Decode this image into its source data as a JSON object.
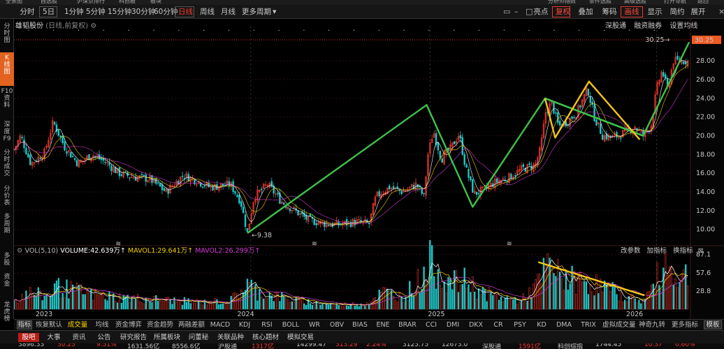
{
  "menu_bar": {
    "items": [
      "全景图",
      "自选股",
      "沪深京排行",
      "科创板",
      "板块"
    ],
    "right_items": [
      "分析师指数",
      "条件选股",
      "高级选股",
      "打开导航",
      "返回"
    ]
  },
  "period_toolbar": {
    "periods": [
      "分时",
      "5日",
      "1分钟",
      "5分钟",
      "15分钟",
      "30分钟",
      "60分钟",
      "日线",
      "周线",
      "月线",
      "更多周期"
    ],
    "dropdown_suffix": "▼",
    "active_period": "日线",
    "right_buttons": [
      "亮点",
      "复权",
      "叠加",
      "筹码",
      "画线",
      "显示",
      "简约",
      "展开"
    ],
    "red_buttons": [
      "复权",
      "画线"
    ]
  },
  "sidebar": {
    "items": [
      "分\n时\n图",
      "K\n线\n图",
      "F10\n资\n料",
      "深\n度\nF9",
      "分\n时\n成\n交",
      "分\n价\n表",
      "多\n周\n期",
      "多\n股",
      "资\n金",
      "龙\n虎\n榜"
    ],
    "active_item": "K\n线\n图"
  },
  "chart_header": {
    "stock_name": "雄韬股份",
    "mode": "(日线,前复权)",
    "settings_icon": "gear-icon",
    "links": [
      "深股通",
      "融资融券",
      "设置均线"
    ]
  },
  "volume_header": {
    "label": "VOL(5,10)",
    "volume": "VOLUME:42.639万",
    "mavol1": "MAVOL1:29.641万",
    "mavol2": "MAVOL2:26.299万",
    "arrow": "↑",
    "links": [
      "改参数",
      "加指标",
      "换指标"
    ],
    "colors": {
      "label": "#bbbbbb",
      "volume": "#ffffff",
      "mavol1": "#f5d000",
      "mavol2": "#d43ad4"
    }
  },
  "indicator_tabs": {
    "items": [
      "指标",
      "恢复默认",
      "成交量",
      "均线",
      "资金博弈",
      "资金趋势",
      "两融差额",
      "MACD",
      "KDJ",
      "RSI",
      "BOLL",
      "WR",
      "OBV",
      "BIAS",
      "ENE",
      "BRAR",
      "CCI",
      "DMI",
      "DKX",
      "CR",
      "PSY",
      "KD",
      "DMA",
      "TRIX",
      "虚拟成交量",
      "神奇九转",
      "更多指标",
      "模板"
    ],
    "active": "成交量"
  },
  "bottom_tabs": {
    "items": [
      "股吧",
      "大事",
      "资讯",
      "公告",
      "研究报告",
      "所属板块",
      "问董秘",
      "关联品种",
      "核心题材",
      "模拟交易"
    ],
    "active": "股吧"
  },
  "status_bar": {
    "items": [
      "3896.33",
      "30.25",
      "9.51%",
      "1631.56亿",
      "8556.6亿",
      "沪股通",
      "1317亿",
      "14299.47",
      "313.29",
      "2.24%",
      "3125.75",
      "12673.0",
      "深股通",
      "1591亿",
      "科创综指",
      "1744.45",
      "10.37",
      "0.60%"
    ]
  },
  "colors": {
    "up": "#ff3b30",
    "down": "#1ec8c8",
    "trend_line": "#3ec24a",
    "highlight_line": "#f5c518",
    "price_label_bg": "#ee5a24",
    "ma5": "#ffffff",
    "ma10": "#f5d000",
    "ma20": "#d43ad4"
  },
  "chart_data": [
    {
      "type": "candlestick",
      "title": "雄韬股份 (日线,前复权)",
      "x_labels": [
        "2023",
        "2024",
        "2025",
        "2026"
      ],
      "y_ticks": [
        10.0,
        12.0,
        14.0,
        16.0,
        18.0,
        20.0,
        22.0,
        24.0,
        26.0,
        28.0
      ],
      "ylim": [
        9.0,
        31.0
      ],
      "current_price": 30.25,
      "high_label": "30.25",
      "low_label": "9.38",
      "price_path": [
        [
          0,
          18.5
        ],
        [
          10,
          20.0
        ],
        [
          25,
          17.0
        ],
        [
          45,
          18.2
        ],
        [
          58,
          21.5
        ],
        [
          75,
          18.8
        ],
        [
          95,
          17.0
        ],
        [
          115,
          18.0
        ],
        [
          135,
          17.2
        ],
        [
          155,
          16.0
        ],
        [
          175,
          15.6
        ],
        [
          200,
          15.4
        ],
        [
          225,
          14.0
        ],
        [
          250,
          15.8
        ],
        [
          270,
          15.2
        ],
        [
          290,
          14.5
        ],
        [
          320,
          14.8
        ],
        [
          335,
          13.0
        ],
        [
          345,
          9.6
        ],
        [
          355,
          13.5
        ],
        [
          375,
          14.8
        ],
        [
          395,
          13.0
        ],
        [
          415,
          12.0
        ],
        [
          435,
          11.0
        ],
        [
          460,
          10.6
        ],
        [
          480,
          10.5
        ],
        [
          505,
          10.8
        ],
        [
          525,
          10.6
        ],
        [
          535,
          13.5
        ],
        [
          555,
          14.5
        ],
        [
          575,
          14.0
        ],
        [
          595,
          14.8
        ],
        [
          606,
          13.5
        ],
        [
          612,
          18.0
        ],
        [
          620,
          20.5
        ],
        [
          632,
          17.5
        ],
        [
          645,
          18.6
        ],
        [
          658,
          20.2
        ],
        [
          668,
          16.5
        ],
        [
          680,
          13.8
        ],
        [
          695,
          14.2
        ],
        [
          710,
          15.0
        ],
        [
          730,
          15.5
        ],
        [
          752,
          16.5
        ],
        [
          770,
          16.8
        ],
        [
          778,
          18.5
        ],
        [
          786,
          22.5
        ],
        [
          795,
          23.5
        ],
        [
          805,
          21.0
        ],
        [
          818,
          21.5
        ],
        [
          832,
          22.5
        ],
        [
          848,
          25.0
        ],
        [
          858,
          22.0
        ],
        [
          870,
          20.0
        ],
        [
          885,
          19.8
        ],
        [
          905,
          20.4
        ],
        [
          918,
          21.0
        ],
        [
          930,
          20.0
        ],
        [
          942,
          21.2
        ],
        [
          950,
          25.0
        ],
        [
          958,
          27.0
        ],
        [
          966,
          25.0
        ],
        [
          975,
          28.0
        ]
      ],
      "green_trend_points": [
        [
          9.6,
          0
        ],
        [
          23.3,
          1
        ],
        [
          12.4,
          2
        ],
        [
          24.0,
          3
        ],
        [
          20.0,
          4
        ],
        [
          30.0,
          5
        ]
      ],
      "green_trend_x_days": [
        345,
        610,
        678,
        785,
        930,
        998
      ],
      "yellow_lines": [
        [
          [
            785,
            24.0
          ],
          [
            800,
            19.8
          ],
          [
            850,
            25.8
          ],
          [
            925,
            19.6
          ]
        ]
      ],
      "green_side_line": [
        [
          785,
          24.0
        ],
        [
          930,
          20.0
        ]
      ]
    },
    {
      "type": "bar",
      "title": "VOL(5,10)",
      "y_ticks": [
        28.8,
        57.6,
        87.1
      ],
      "ylim": [
        0,
        90
      ],
      "volume_levels": [
        [
          0,
          15
        ],
        [
          20,
          30
        ],
        [
          50,
          22
        ],
        [
          60,
          40
        ],
        [
          80,
          35
        ],
        [
          120,
          25
        ],
        [
          160,
          20
        ],
        [
          200,
          18
        ],
        [
          240,
          15
        ],
        [
          280,
          12
        ],
        [
          320,
          15
        ],
        [
          345,
          45
        ],
        [
          360,
          30
        ],
        [
          400,
          20
        ],
        [
          440,
          12
        ],
        [
          480,
          8
        ],
        [
          520,
          10
        ],
        [
          545,
          30
        ],
        [
          575,
          22
        ],
        [
          606,
          60
        ],
        [
          612,
          85
        ],
        [
          625,
          70
        ],
        [
          645,
          45
        ],
        [
          670,
          50
        ],
        [
          690,
          30
        ],
        [
          720,
          20
        ],
        [
          750,
          15
        ],
        [
          778,
          50
        ],
        [
          790,
          80
        ],
        [
          805,
          60
        ],
        [
          830,
          50
        ],
        [
          850,
          48
        ],
        [
          870,
          40
        ],
        [
          890,
          30
        ],
        [
          910,
          20
        ],
        [
          930,
          15
        ],
        [
          945,
          40
        ],
        [
          955,
          65
        ],
        [
          965,
          85
        ],
        [
          975,
          60
        ]
      ],
      "yellow_line": [
        [
          775,
          75
        ],
        [
          932,
          22
        ]
      ]
    }
  ]
}
